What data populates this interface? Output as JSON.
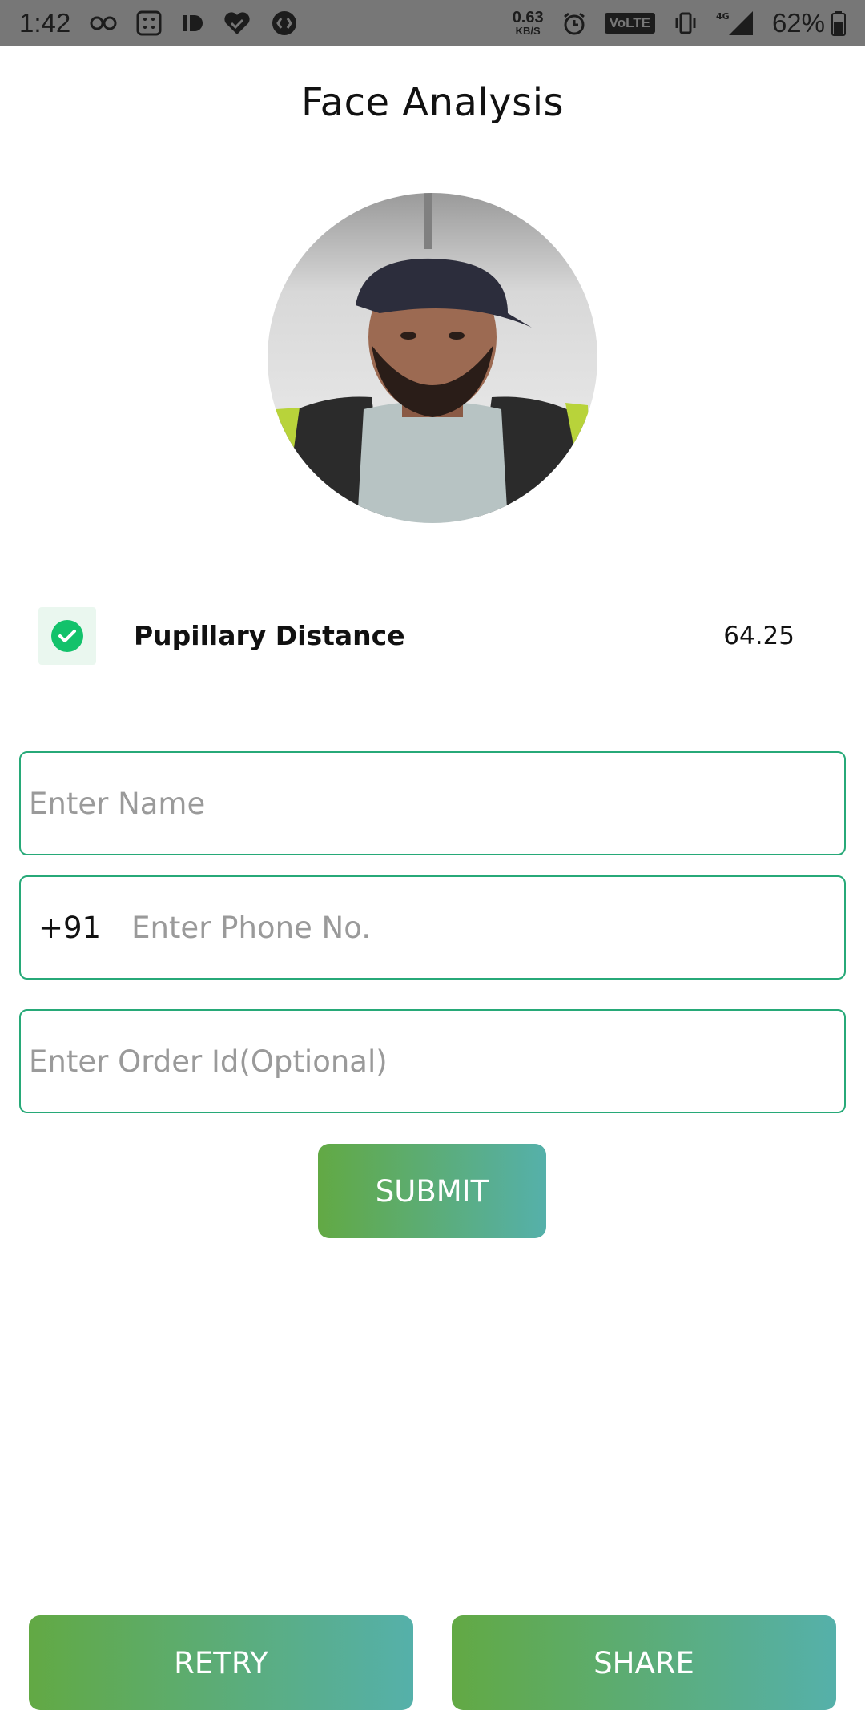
{
  "status_bar": {
    "time": "1:42",
    "net_speed_value": "0.63",
    "net_speed_unit": "KB/S",
    "volte": "VoLTE",
    "network": "4G",
    "battery_percent": "62%"
  },
  "page": {
    "title": "Face Analysis"
  },
  "measurement": {
    "label": "Pupillary Distance",
    "value": "64.25"
  },
  "form": {
    "name_placeholder": "Enter Name",
    "country_code": "+91",
    "phone_placeholder": "Enter Phone No.",
    "order_placeholder": "Enter Order Id(Optional)"
  },
  "buttons": {
    "submit": "SUBMIT",
    "retry": "RETRY",
    "share": "SHARE"
  },
  "colors": {
    "accent_border": "#27a978",
    "gradient_start": "#62a944",
    "gradient_end": "#55b0aa",
    "check_green": "#13c26b"
  }
}
